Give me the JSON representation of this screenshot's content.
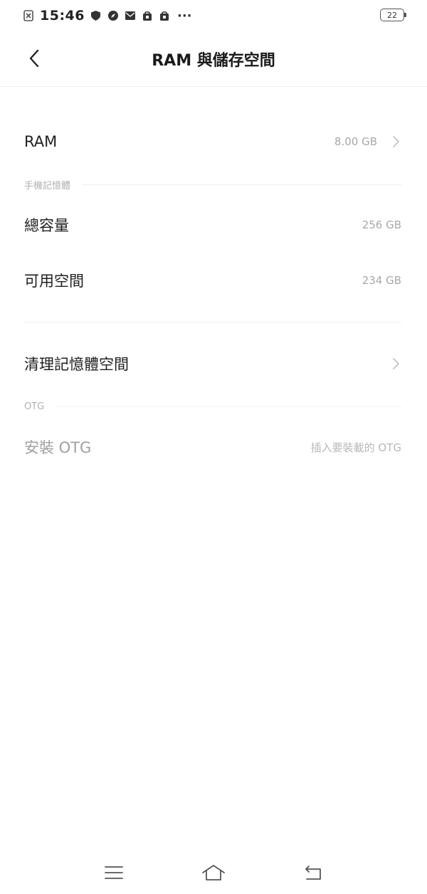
{
  "status_bar": {
    "time": "15:46",
    "battery": "22",
    "more": "···",
    "icons": [
      "sim-icon",
      "shield-icon",
      "compass-icon",
      "mail-icon",
      "bag-icon",
      "bag-icon"
    ]
  },
  "header": {
    "title": "RAM 與儲存空間",
    "back_icon": "chevron-left-icon"
  },
  "ram": {
    "label": "RAM",
    "value": "8.00 GB"
  },
  "phone_memory": {
    "section_label": "手機記憶體",
    "total_label": "總容量",
    "total_value": "256 GB",
    "available_label": "可用空間",
    "available_value": "234 GB"
  },
  "cleanup": {
    "label": "清理記憶體空間"
  },
  "otg": {
    "section_label": "OTG",
    "install_label": "安裝 OTG",
    "install_hint": "插入要裝載的 OTG"
  },
  "nav": {
    "icons": [
      "menu-icon",
      "home-icon",
      "back-icon"
    ]
  },
  "colors": {
    "text_primary": "#1f1f1f",
    "text_secondary": "#a8a8a8",
    "divider": "#efefef"
  }
}
